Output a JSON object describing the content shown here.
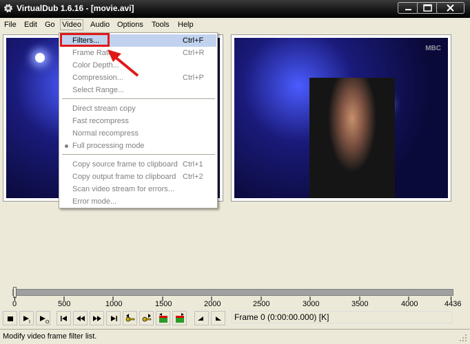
{
  "window": {
    "title": "VirtualDub 1.6.16 - [movie.avi]"
  },
  "menubar": [
    {
      "id": "file",
      "label": "File"
    },
    {
      "id": "edit",
      "label": "Edit"
    },
    {
      "id": "go",
      "label": "Go"
    },
    {
      "id": "video",
      "label": "Video"
    },
    {
      "id": "audio",
      "label": "Audio"
    },
    {
      "id": "options",
      "label": "Options"
    },
    {
      "id": "tools",
      "label": "Tools"
    },
    {
      "id": "help",
      "label": "Help"
    }
  ],
  "video_menu": {
    "items": [
      {
        "label": "Filters...",
        "shortcut": "Ctrl+F",
        "highlighted": true
      },
      {
        "label": "Frame Rate...",
        "shortcut": "Ctrl+R"
      },
      {
        "label": "Color Depth...",
        "shortcut": ""
      },
      {
        "label": "Compression...",
        "shortcut": "Ctrl+P"
      },
      {
        "label": "Select Range...",
        "shortcut": ""
      },
      {
        "label": "Direct stream copy",
        "shortcut": ""
      },
      {
        "label": "Fast recompress",
        "shortcut": ""
      },
      {
        "label": "Normal recompress",
        "shortcut": ""
      },
      {
        "label": "Full processing mode",
        "shortcut": "",
        "checked": true
      },
      {
        "label": "Copy source frame to clipboard",
        "shortcut": "Ctrl+1"
      },
      {
        "label": "Copy output frame to clipboard",
        "shortcut": "Ctrl+2"
      },
      {
        "label": "Scan video stream for errors...",
        "shortcut": ""
      },
      {
        "label": "Error mode...",
        "shortcut": ""
      }
    ]
  },
  "preview": {
    "channel_logo": "MBC"
  },
  "timeline": {
    "ticks": [
      "0",
      "500",
      "1000",
      "1500",
      "2000",
      "2500",
      "3000",
      "3500",
      "4000",
      "4436"
    ],
    "position": 0,
    "max": 4436
  },
  "frame_display": "Frame 0 (0:00:00.000) [K]",
  "status": "Modify video frame filter list.",
  "colors": {
    "highlight": "#c1d2ee",
    "annotation": "#e01818",
    "titlebar": "#1a1a1a"
  }
}
